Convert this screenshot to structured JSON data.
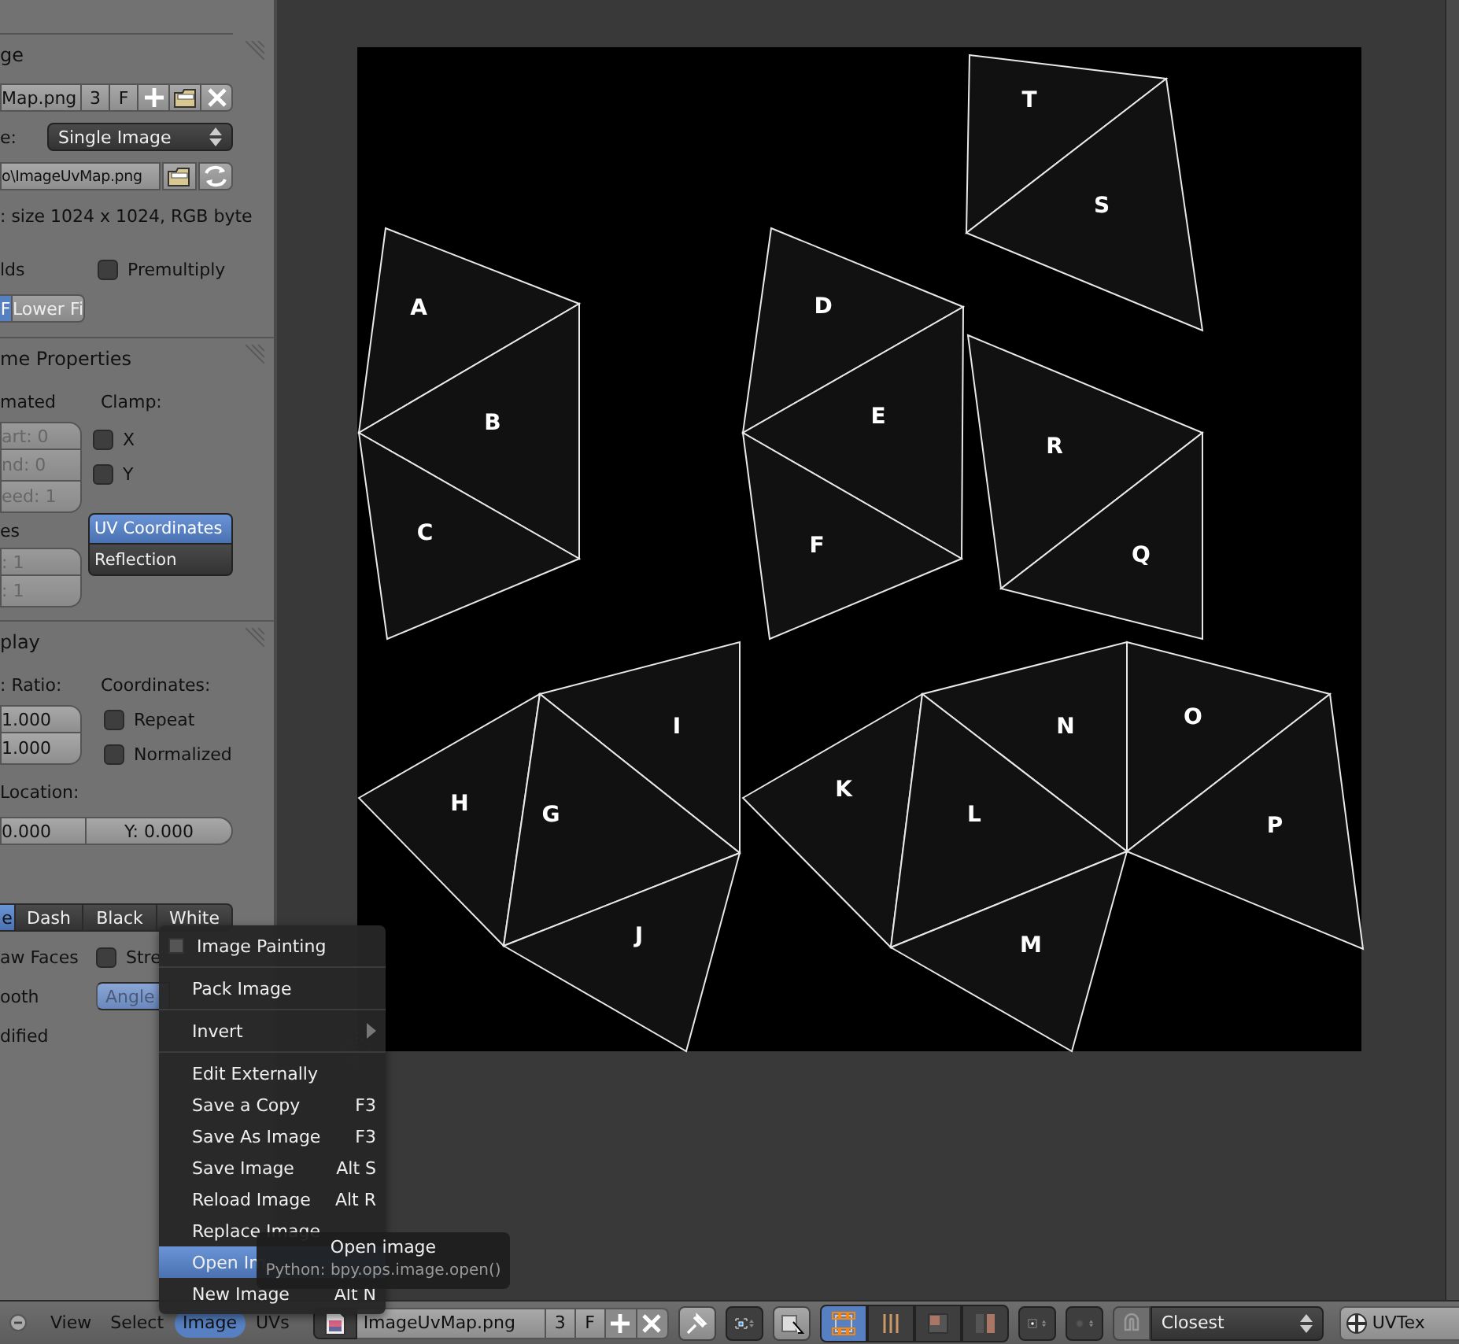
{
  "properties_panel": {
    "image": {
      "header": "ge",
      "name_field": "Map.png",
      "users": "3",
      "fake_user": "F",
      "source_label": "e:",
      "source": "Single Image",
      "filepath": "o\\ImageUvMap.png",
      "info": ": size 1024 x 1024, RGB byte",
      "fields_label": "lds",
      "premultiply": {
        "label": "Premultiply",
        "checked": false
      },
      "fields_toggle": [
        {
          "label": "F",
          "selected": true
        },
        {
          "label": "Lower Fi",
          "selected": false
        }
      ]
    },
    "game": {
      "header": "me Properties",
      "animated_label": "mated",
      "clamp_label": "Clamp:",
      "anim_fields": [
        {
          "label": "art: 0"
        },
        {
          "label": "nd: 0"
        },
        {
          "label": "eed: 1"
        }
      ],
      "clamp": [
        {
          "label": "X",
          "checked": false
        },
        {
          "label": "Y",
          "checked": false
        }
      ],
      "mapping": [
        {
          "label": "UV Coordinates",
          "selected": true
        },
        {
          "label": "Reflection",
          "selected": false
        }
      ],
      "tiles_label": "es",
      "tile_fields": [
        {
          "label": ": 1"
        },
        {
          "label": ": 1"
        }
      ]
    },
    "display": {
      "header": "play",
      "ratio_label": ": Ratio:",
      "coords_label": "Coordinates:",
      "ratio_fields": [
        {
          "label": "1.000"
        },
        {
          "label": "1.000"
        }
      ],
      "coords": [
        {
          "label": "Repeat",
          "checked": false
        },
        {
          "label": "Normalized",
          "checked": false
        }
      ],
      "location_label": "Location:",
      "location_fields": [
        {
          "label": "0.000"
        },
        {
          "label": "Y: 0.000"
        }
      ],
      "edge_styles": [
        {
          "label": "e",
          "selected": true
        },
        {
          "label": "Dash",
          "selected": false
        },
        {
          "label": "Black",
          "selected": false
        },
        {
          "label": "White",
          "selected": false
        }
      ],
      "faces_label": "aw Faces",
      "stretch": {
        "label": "Stre",
        "checked": false
      },
      "smooth_label": "ooth",
      "stretch_modes": [
        {
          "label": "Angle",
          "selected": true
        }
      ],
      "modified_label": "dified"
    }
  },
  "uv_labels": [
    "T",
    "S",
    "A",
    "B",
    "C",
    "D",
    "E",
    "F",
    "R",
    "Q",
    "I",
    "H",
    "G",
    "J",
    "K",
    "N",
    "O",
    "L",
    "P",
    "M"
  ],
  "image_menu": [
    {
      "kind": "check",
      "label": "Image Painting",
      "checked": false
    },
    {
      "kind": "separator"
    },
    {
      "kind": "item",
      "label": "Pack Image",
      "selected": false
    },
    {
      "kind": "separator"
    },
    {
      "kind": "submenu",
      "label": "Invert",
      "selected": false
    },
    {
      "kind": "separator"
    },
    {
      "kind": "item",
      "label": "Edit Externally",
      "selected": false
    },
    {
      "kind": "item",
      "label": "Save a Copy",
      "shortcut": "F3",
      "selected": false
    },
    {
      "kind": "item",
      "label": "Save As Image",
      "shortcut": "F3",
      "selected": false
    },
    {
      "kind": "item",
      "label": "Save Image",
      "shortcut": "Alt S",
      "selected": false
    },
    {
      "kind": "item",
      "label": "Reload Image",
      "shortcut": "Alt R",
      "selected": false
    },
    {
      "kind": "item",
      "label": "Replace Image",
      "selected": false
    },
    {
      "kind": "item",
      "label": "Open Im",
      "selected": true
    },
    {
      "kind": "item",
      "label": "New Image",
      "shortcut": "Alt N",
      "selected": false
    }
  ],
  "tooltip": {
    "title": "Open image",
    "python": "Python: bpy.ops.image.open()"
  },
  "header": {
    "menus": [
      {
        "label": "View",
        "selected": false
      },
      {
        "label": "Select",
        "selected": false
      },
      {
        "label": "Image",
        "selected": true
      },
      {
        "label": "UVs",
        "selected": false
      }
    ],
    "image_name": "ImageUvMap.png",
    "users": "3",
    "fake_user": "F",
    "select_modes": [
      {
        "selected": true
      },
      {
        "selected": false
      },
      {
        "selected": false
      },
      {
        "selected": false
      }
    ],
    "snap_target": "Closest",
    "uv_map": "UVTex"
  }
}
